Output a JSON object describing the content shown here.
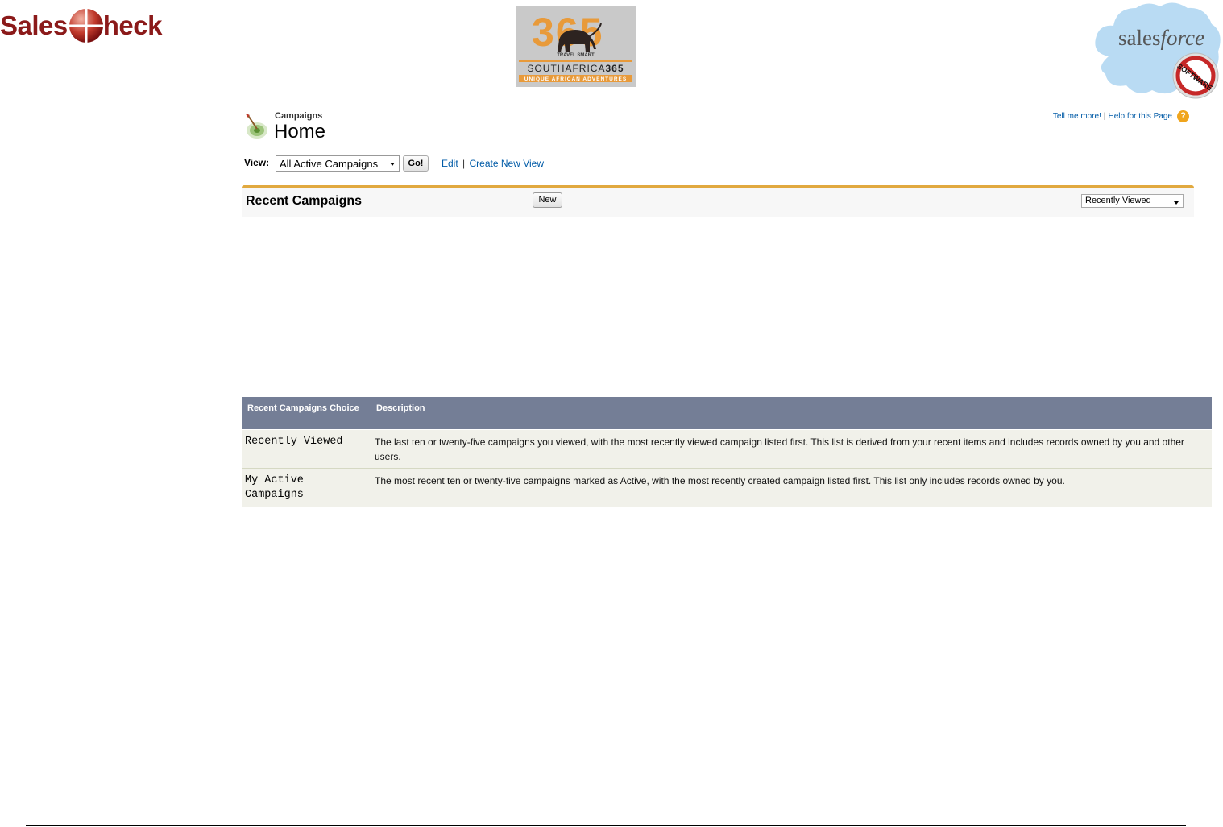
{
  "logos": {
    "salescheck": "SalesCheck",
    "salescheck_left": "Sales",
    "salescheck_right": "heck",
    "southafrica365": {
      "digits": "365",
      "tagline_top": "TRAVEL SMART",
      "name_a": "SOUTHAFRICA",
      "name_b": "365",
      "tagline_bottom": "UNIQUE AFRICAN ADVENTURES"
    },
    "salesforce": {
      "wordmark_a": "sales",
      "wordmark_b": "force",
      "stamp": "SOFTWARE"
    }
  },
  "header": {
    "breadcrumb": "Campaigns",
    "title": "Home",
    "help_tell_more": "Tell me more!",
    "help_separator": "|",
    "help_page": "Help for this Page",
    "help_icon": "?"
  },
  "view_bar": {
    "label": "View:",
    "selected": "All Active Campaigns",
    "go_label": "Go!",
    "edit_link": "Edit",
    "separator": "|",
    "create_link": "Create New View"
  },
  "recent": {
    "title": "Recent Campaigns",
    "new_label": "New",
    "filter_selected": "Recently Viewed"
  },
  "table": {
    "headers": [
      "Recent Campaigns Choice",
      "Description"
    ],
    "rows": [
      {
        "choice": "Recently Viewed",
        "description": "The last ten or twenty-five campaigns you viewed, with the most recently viewed campaign listed first. This list is derived from your recent items and includes records owned by you and other users."
      },
      {
        "choice": "My Active Campaigns",
        "description": "The most recent ten or twenty-five campaigns marked as Active, with the most recently created campaign listed first. This list only includes records owned by you."
      }
    ]
  },
  "colors": {
    "accent_orange": "#e1a93f",
    "link_blue": "#015ba7",
    "table_header": "#747e96",
    "table_row": "#f1f1ea",
    "brand_red": "#8b1a1a"
  },
  "icons": {
    "app": "campaign-target-icon",
    "help": "help-icon",
    "dropdown": "chevron-down-icon"
  }
}
